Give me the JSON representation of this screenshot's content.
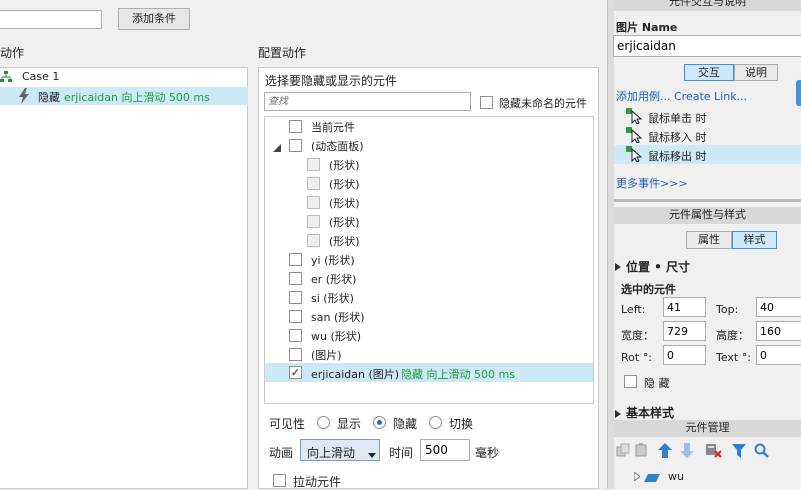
{
  "top": {
    "add_condition": "添加条件"
  },
  "left": {
    "section_title": "触动作",
    "case_label": "Case 1",
    "action_verb": "隐藏",
    "action_detail": "erjicaidan 向上滑动 500 ms"
  },
  "middle": {
    "section_title": "配置动作",
    "panel_title": "选择要隐藏或显示的元件",
    "search_placeholder": "查找",
    "hide_unnamed_label": "隐藏未命名的元件",
    "tree": [
      {
        "label": "当前元件",
        "checked": false
      },
      {
        "label": "(动态面板)",
        "checked": false
      },
      {
        "label": "(形状)",
        "checked": false
      },
      {
        "label": "(形状)",
        "checked": false
      },
      {
        "label": "(形状)",
        "checked": false
      },
      {
        "label": "(形状)",
        "checked": false
      },
      {
        "label": "(形状)",
        "checked": false
      },
      {
        "label": "yi (形状)",
        "checked": false
      },
      {
        "label": "er (形状)",
        "checked": false
      },
      {
        "label": "si (形状)",
        "checked": false
      },
      {
        "label": "san (形状)",
        "checked": false
      },
      {
        "label": "wu (形状)",
        "checked": false
      },
      {
        "label": "(图片)",
        "checked": false
      },
      {
        "label": "erjicaidan (图片)",
        "checked": true,
        "detail": "隐藏 向上滑动 500 ms"
      }
    ],
    "visibility_label": "可见性",
    "opt_show": "显示",
    "opt_hide": "隐藏",
    "opt_toggle": "切换",
    "selected_visibility": "隐藏",
    "animation_label": "动画",
    "animation_value": "向上滑动",
    "time_label": "时间",
    "time_value": "500",
    "time_unit": "毫秒",
    "drag_label": "拉动元件"
  },
  "right": {
    "top_header": "元件交互与说明",
    "name_label": "图片 Name",
    "name_value": "erjicaidan",
    "tab_interaction": "交互",
    "tab_notes": "说明",
    "add_case_link": "添加用例... Create Link...",
    "events": [
      "鼠标单击 时",
      "鼠标移入 时",
      "鼠标移出 时"
    ],
    "more_events": "更多事件>>>",
    "props_header": "元件属性与样式",
    "tab_props": "属性",
    "tab_style": "样式",
    "pos_size_title": "位置 • 尺寸",
    "selected_label": "选中的元件",
    "left_label": "Left:",
    "left_value": "41",
    "top_label": "Top:",
    "top_value": "40",
    "width_label": "宽度：",
    "width_value": "729",
    "height_label": "高度：",
    "height_value": "160",
    "rot_label": "Rot °:",
    "rot_value": "0",
    "text_rot_label": "Text °:",
    "text_rot_value": "0",
    "hidden_label": "隐 藏",
    "base_style_title": "基本样式",
    "manager_header": "元件管理",
    "manager_item": "wu",
    "accent": "#3c8fd8",
    "green": "#1e9e3a"
  }
}
